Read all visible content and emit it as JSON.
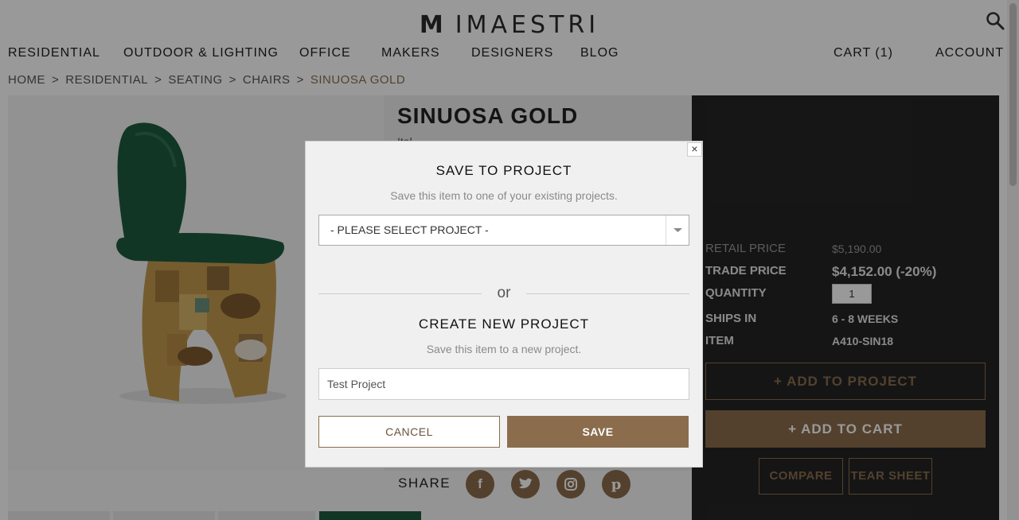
{
  "brand": {
    "logo_mark": "M",
    "logo_text": "IMAESTRI"
  },
  "nav": {
    "items": [
      "RESIDENTIAL",
      "OUTDOOR & LIGHTING",
      "OFFICE",
      "MAKERS",
      "DESIGNERS",
      "BLOG"
    ],
    "cart": "CART (1)",
    "account": "ACCOUNT"
  },
  "breadcrumb": [
    "HOME",
    "RESIDENTIAL",
    "SEATING",
    "CHAIRS",
    "SINUOSA GOLD"
  ],
  "breadcrumb_separator": ">",
  "product": {
    "title": "SINUOSA GOLD",
    "subtitle": "Ital"
  },
  "pricing": {
    "retail_label": "RETAIL PRICE",
    "retail_value": "$5,190.00",
    "trade_label": "TRADE PRICE",
    "trade_value": "$4,152.00 (-20%)",
    "quantity_label": "QUANTITY",
    "quantity_value": "1",
    "ships_label": "SHIPS IN",
    "ships_value": "6 - 8 WEEKS",
    "item_label": "ITEM",
    "item_value": "A410-SIN18"
  },
  "actions": {
    "add_to_project": "+ ADD TO PROJECT",
    "add_to_cart": "+ ADD TO CART",
    "compare": "COMPARE",
    "tear_sheet": "TEAR SHEET"
  },
  "share": {
    "label": "SHARE",
    "icons": [
      "facebook-icon",
      "twitter-icon",
      "instagram-icon",
      "pinterest-icon"
    ]
  },
  "modal": {
    "close": "×",
    "save_title": "SAVE TO PROJECT",
    "save_subtitle": "Save this item to one of your existing projects.",
    "select_value": "- PLEASE SELECT PROJECT -",
    "or": "or",
    "create_title": "CREATE NEW PROJECT",
    "create_subtitle": "Save this item to a new project.",
    "input_value": "Test Project",
    "cancel": "CANCEL",
    "save": "SAVE"
  },
  "colors": {
    "accent": "#8b6d4d",
    "panel": "#242424",
    "chair_green": "#1f5a3e",
    "chair_gold": "#c49a4f"
  }
}
